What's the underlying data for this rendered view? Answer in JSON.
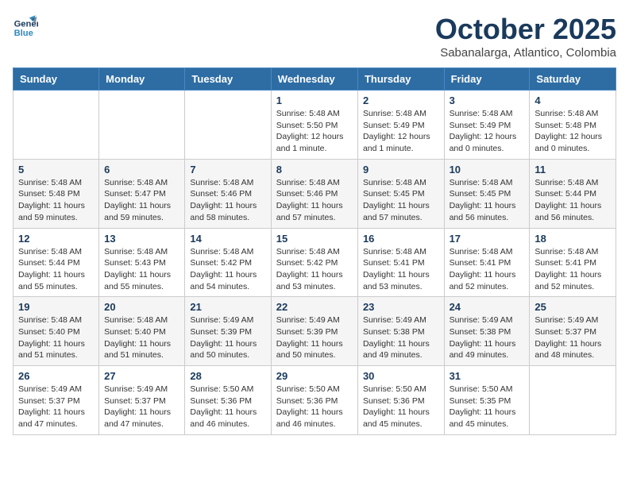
{
  "logo": {
    "line1": "General",
    "line2": "Blue"
  },
  "title": "October 2025",
  "subtitle": "Sabanalarga, Atlantico, Colombia",
  "weekdays": [
    "Sunday",
    "Monday",
    "Tuesday",
    "Wednesday",
    "Thursday",
    "Friday",
    "Saturday"
  ],
  "weeks": [
    [
      {
        "day": "",
        "info": ""
      },
      {
        "day": "",
        "info": ""
      },
      {
        "day": "",
        "info": ""
      },
      {
        "day": "1",
        "info": "Sunrise: 5:48 AM\nSunset: 5:50 PM\nDaylight: 12 hours\nand 1 minute."
      },
      {
        "day": "2",
        "info": "Sunrise: 5:48 AM\nSunset: 5:49 PM\nDaylight: 12 hours\nand 1 minute."
      },
      {
        "day": "3",
        "info": "Sunrise: 5:48 AM\nSunset: 5:49 PM\nDaylight: 12 hours\nand 0 minutes."
      },
      {
        "day": "4",
        "info": "Sunrise: 5:48 AM\nSunset: 5:48 PM\nDaylight: 12 hours\nand 0 minutes."
      }
    ],
    [
      {
        "day": "5",
        "info": "Sunrise: 5:48 AM\nSunset: 5:48 PM\nDaylight: 11 hours\nand 59 minutes."
      },
      {
        "day": "6",
        "info": "Sunrise: 5:48 AM\nSunset: 5:47 PM\nDaylight: 11 hours\nand 59 minutes."
      },
      {
        "day": "7",
        "info": "Sunrise: 5:48 AM\nSunset: 5:46 PM\nDaylight: 11 hours\nand 58 minutes."
      },
      {
        "day": "8",
        "info": "Sunrise: 5:48 AM\nSunset: 5:46 PM\nDaylight: 11 hours\nand 57 minutes."
      },
      {
        "day": "9",
        "info": "Sunrise: 5:48 AM\nSunset: 5:45 PM\nDaylight: 11 hours\nand 57 minutes."
      },
      {
        "day": "10",
        "info": "Sunrise: 5:48 AM\nSunset: 5:45 PM\nDaylight: 11 hours\nand 56 minutes."
      },
      {
        "day": "11",
        "info": "Sunrise: 5:48 AM\nSunset: 5:44 PM\nDaylight: 11 hours\nand 56 minutes."
      }
    ],
    [
      {
        "day": "12",
        "info": "Sunrise: 5:48 AM\nSunset: 5:44 PM\nDaylight: 11 hours\nand 55 minutes."
      },
      {
        "day": "13",
        "info": "Sunrise: 5:48 AM\nSunset: 5:43 PM\nDaylight: 11 hours\nand 55 minutes."
      },
      {
        "day": "14",
        "info": "Sunrise: 5:48 AM\nSunset: 5:42 PM\nDaylight: 11 hours\nand 54 minutes."
      },
      {
        "day": "15",
        "info": "Sunrise: 5:48 AM\nSunset: 5:42 PM\nDaylight: 11 hours\nand 53 minutes."
      },
      {
        "day": "16",
        "info": "Sunrise: 5:48 AM\nSunset: 5:41 PM\nDaylight: 11 hours\nand 53 minutes."
      },
      {
        "day": "17",
        "info": "Sunrise: 5:48 AM\nSunset: 5:41 PM\nDaylight: 11 hours\nand 52 minutes."
      },
      {
        "day": "18",
        "info": "Sunrise: 5:48 AM\nSunset: 5:41 PM\nDaylight: 11 hours\nand 52 minutes."
      }
    ],
    [
      {
        "day": "19",
        "info": "Sunrise: 5:48 AM\nSunset: 5:40 PM\nDaylight: 11 hours\nand 51 minutes."
      },
      {
        "day": "20",
        "info": "Sunrise: 5:48 AM\nSunset: 5:40 PM\nDaylight: 11 hours\nand 51 minutes."
      },
      {
        "day": "21",
        "info": "Sunrise: 5:49 AM\nSunset: 5:39 PM\nDaylight: 11 hours\nand 50 minutes."
      },
      {
        "day": "22",
        "info": "Sunrise: 5:49 AM\nSunset: 5:39 PM\nDaylight: 11 hours\nand 50 minutes."
      },
      {
        "day": "23",
        "info": "Sunrise: 5:49 AM\nSunset: 5:38 PM\nDaylight: 11 hours\nand 49 minutes."
      },
      {
        "day": "24",
        "info": "Sunrise: 5:49 AM\nSunset: 5:38 PM\nDaylight: 11 hours\nand 49 minutes."
      },
      {
        "day": "25",
        "info": "Sunrise: 5:49 AM\nSunset: 5:37 PM\nDaylight: 11 hours\nand 48 minutes."
      }
    ],
    [
      {
        "day": "26",
        "info": "Sunrise: 5:49 AM\nSunset: 5:37 PM\nDaylight: 11 hours\nand 47 minutes."
      },
      {
        "day": "27",
        "info": "Sunrise: 5:49 AM\nSunset: 5:37 PM\nDaylight: 11 hours\nand 47 minutes."
      },
      {
        "day": "28",
        "info": "Sunrise: 5:50 AM\nSunset: 5:36 PM\nDaylight: 11 hours\nand 46 minutes."
      },
      {
        "day": "29",
        "info": "Sunrise: 5:50 AM\nSunset: 5:36 PM\nDaylight: 11 hours\nand 46 minutes."
      },
      {
        "day": "30",
        "info": "Sunrise: 5:50 AM\nSunset: 5:36 PM\nDaylight: 11 hours\nand 45 minutes."
      },
      {
        "day": "31",
        "info": "Sunrise: 5:50 AM\nSunset: 5:35 PM\nDaylight: 11 hours\nand 45 minutes."
      },
      {
        "day": "",
        "info": ""
      }
    ]
  ]
}
